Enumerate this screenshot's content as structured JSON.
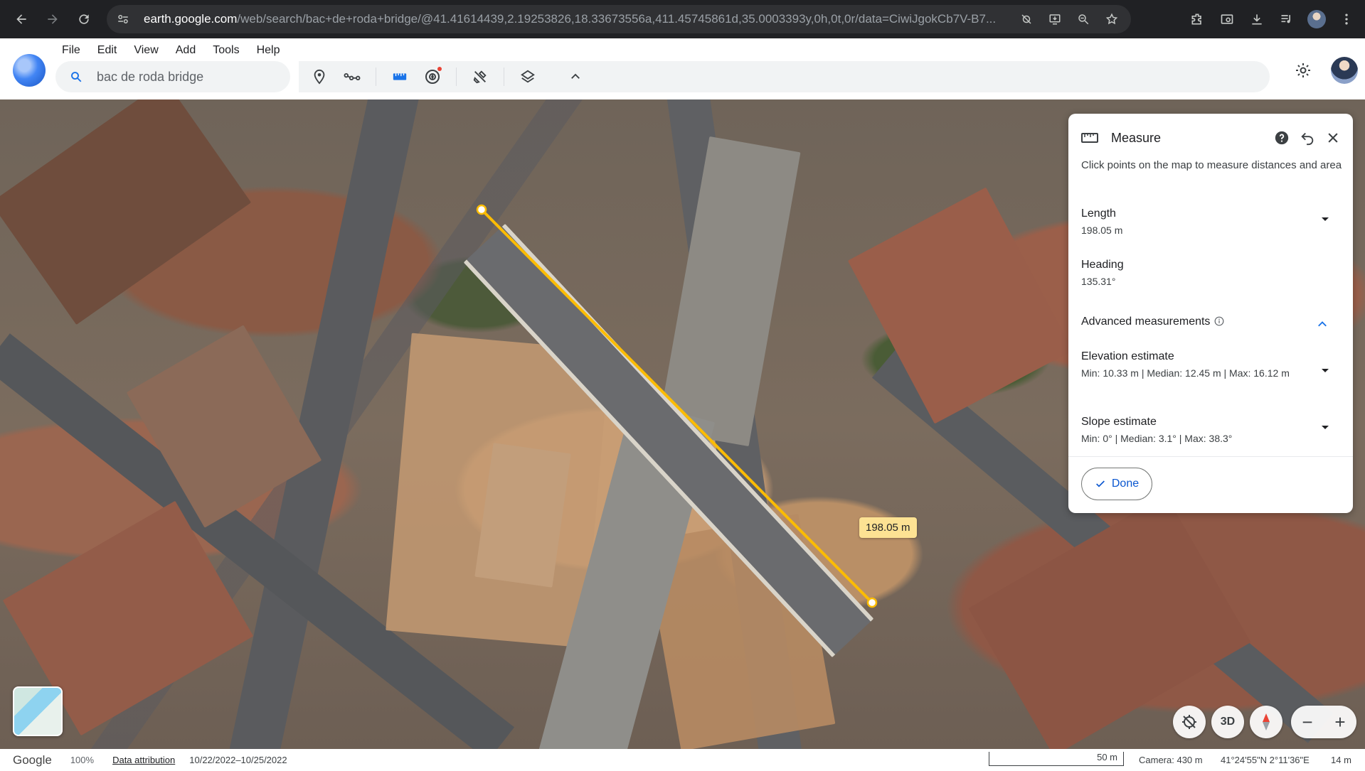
{
  "browser": {
    "url_host": "earth.google.com",
    "url_rest": "/web/search/bac+de+roda+bridge/@41.41614439,2.19253826,18.33673556a,411.45745861d,35.0003393y,0h,0t,0r/data=CiwiJgokCb7V-B7..."
  },
  "menu": [
    "File",
    "Edit",
    "View",
    "Add",
    "Tools",
    "Help"
  ],
  "search": {
    "value": "bac de roda bridge"
  },
  "toolbar": {
    "icons": [
      "place-mark-icon",
      "path-icon",
      "ruler-icon",
      "voyager-icon",
      "tools-icon",
      "layers-icon",
      "collapse-icon"
    ]
  },
  "measure": {
    "title": "Measure",
    "description": "Click points on the map to measure distances and area",
    "length_label": "Length",
    "length_value": "198.05 m",
    "heading_label": "Heading",
    "heading_value": "135.31°",
    "advanced_label": "Advanced measurements",
    "elevation_label": "Elevation estimate",
    "elevation_value": "Min: 10.33 m | Median: 12.45 m | Max: 16.12 m",
    "slope_label": "Slope estimate",
    "slope_value": "Min: 0° | Median: 3.1° | Max: 38.3°",
    "done_label": "Done",
    "map_label": "198.05 m"
  },
  "controls": {
    "three_d": "3D"
  },
  "footer": {
    "logo": "Google",
    "zoom": "100%",
    "attribution": "Data attribution",
    "date_range": "10/22/2022–10/25/2022",
    "scale": "50 m",
    "camera": "Camera: 430 m",
    "coords": "41°24'55\"N 2°11'36\"E",
    "elevation": "14 m"
  },
  "colors": {
    "accent": "#1a73e8",
    "measure_line": "#fbbc04",
    "label_bg": "#fde293"
  }
}
